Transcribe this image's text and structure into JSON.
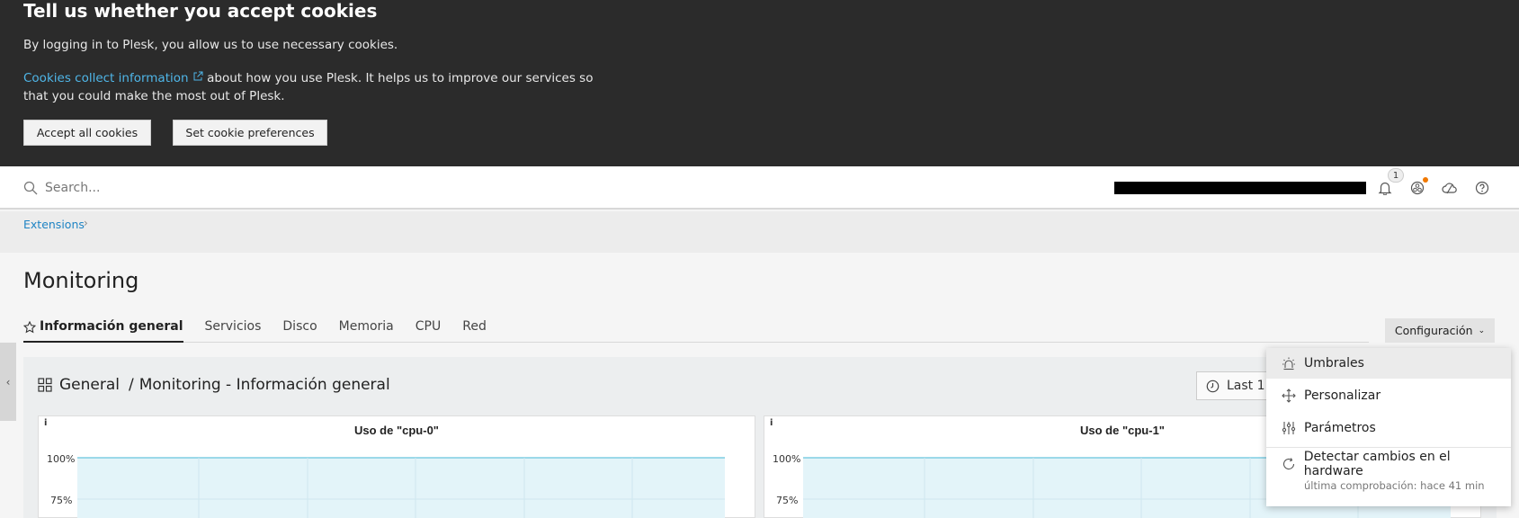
{
  "cookie": {
    "title": "Tell us whether you accept cookies",
    "line1": "By logging in to Plesk, you allow us to use necessary cookies.",
    "link_text": "Cookies collect information",
    "line2_rest": " about how you use Plesk. It helps us to improve our services so that you could make the most out of Plesk.",
    "accept_label": "Accept all cookies",
    "prefs_label": "Set cookie preferences"
  },
  "topbar": {
    "search_placeholder": "Search...",
    "notification_count": "1",
    "icons": [
      "search-icon",
      "bell-icon",
      "extensions-icon",
      "cloud-icon",
      "help-icon"
    ]
  },
  "breadcrumb": {
    "item": "Extensions"
  },
  "page": {
    "title": "Monitoring"
  },
  "tabs": [
    {
      "label": "Información general",
      "active": true
    },
    {
      "label": "Servicios"
    },
    {
      "label": "Disco"
    },
    {
      "label": "Memoria"
    },
    {
      "label": "CPU"
    },
    {
      "label": "Red"
    }
  ],
  "config_button": {
    "label": "Configuración"
  },
  "dashboard": {
    "folder": "General",
    "separator": "/",
    "name": "Monitoring - Información general",
    "time_range": "Last 1"
  },
  "panels": [
    {
      "info": "i",
      "title": "Uso de \"cpu-0\"",
      "y_ticks": [
        "100%",
        "75%"
      ]
    },
    {
      "info": "i",
      "title": "Uso de \"cpu-1\"",
      "y_ticks": [
        "100%",
        "75%"
      ]
    }
  ],
  "menu": {
    "items": [
      {
        "label": "Umbrales",
        "icon": "alarm-icon"
      },
      {
        "label": "Personalizar",
        "icon": "move-icon"
      },
      {
        "label": "Parámetros",
        "icon": "sliders-icon"
      },
      {
        "label": "Detectar cambios en el hardware",
        "icon": "refresh-icon"
      }
    ],
    "note": "última comprobación: hace 41 min"
  },
  "colors": {
    "banner_bg": "#2b2b2b",
    "link": "#4fb6e8",
    "accent_blue": "#1f84c4",
    "chart_fill": "#e3f4f9",
    "chart_line": "#7ecde3",
    "badge_orange": "#f07800"
  }
}
